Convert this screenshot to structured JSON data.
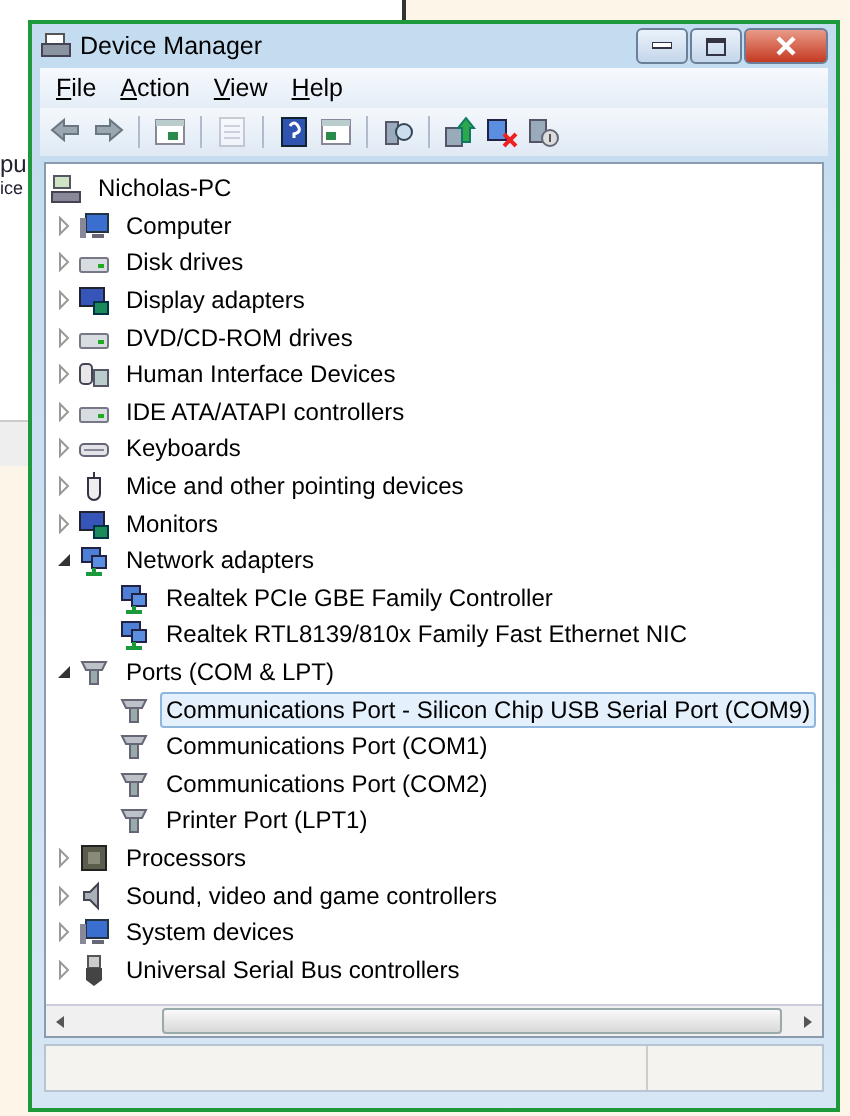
{
  "background_window": {
    "texts": [
      "pu",
      "ice"
    ]
  },
  "window": {
    "title": "Device Manager"
  },
  "menu": [
    "File",
    "Action",
    "View",
    "Help"
  ],
  "toolbar": [
    {
      "kind": "back",
      "disabled": false
    },
    {
      "kind": "forward",
      "disabled": false
    },
    {
      "kind": "tree",
      "disabled": false
    },
    {
      "kind": "properties",
      "disabled": true
    },
    {
      "kind": "help",
      "disabled": false
    },
    {
      "kind": "pane",
      "disabled": false
    },
    {
      "kind": "scan",
      "disabled": false
    },
    {
      "kind": "update",
      "disabled": false
    },
    {
      "kind": "uninstall",
      "disabled": false
    },
    {
      "kind": "disable",
      "disabled": false
    }
  ],
  "tree": {
    "root": {
      "label": "Nicholas-PC",
      "kind": "pc",
      "selected": false,
      "children": [
        {
          "label": "Computer",
          "kind": "computer",
          "expanded": false,
          "selected": false
        },
        {
          "label": "Disk drives",
          "kind": "disk",
          "expanded": false,
          "selected": false
        },
        {
          "label": "Display adapters",
          "kind": "display",
          "expanded": false,
          "selected": false
        },
        {
          "label": "DVD/CD-ROM drives",
          "kind": "disk",
          "expanded": false,
          "selected": false
        },
        {
          "label": "Human Interface Devices",
          "kind": "hid",
          "expanded": false,
          "selected": false
        },
        {
          "label": "IDE ATA/ATAPI controllers",
          "kind": "disk",
          "expanded": false,
          "selected": false
        },
        {
          "label": "Keyboards",
          "kind": "keyboard",
          "expanded": false,
          "selected": false
        },
        {
          "label": "Mice and other pointing devices",
          "kind": "mouse",
          "expanded": false,
          "selected": false
        },
        {
          "label": "Monitors",
          "kind": "display",
          "expanded": false,
          "selected": false
        },
        {
          "label": "Network adapters",
          "kind": "network",
          "expanded": true,
          "selected": false,
          "children": [
            {
              "label": "Realtek PCIe GBE Family Controller",
              "kind": "network",
              "selected": false
            },
            {
              "label": "Realtek RTL8139/810x Family Fast Ethernet NIC",
              "kind": "network",
              "selected": false
            }
          ]
        },
        {
          "label": "Ports (COM & LPT)",
          "kind": "port",
          "expanded": true,
          "selected": false,
          "children": [
            {
              "label": "Communications Port - Silicon Chip USB Serial Port (COM9)",
              "kind": "port",
              "selected": true
            },
            {
              "label": "Communications Port (COM1)",
              "kind": "port",
              "selected": false
            },
            {
              "label": "Communications Port (COM2)",
              "kind": "port",
              "selected": false
            },
            {
              "label": "Printer Port (LPT1)",
              "kind": "port",
              "selected": false
            }
          ]
        },
        {
          "label": "Processors",
          "kind": "chip",
          "expanded": false,
          "selected": false
        },
        {
          "label": "Sound, video and game controllers",
          "kind": "sound",
          "expanded": false,
          "selected": false
        },
        {
          "label": "System devices",
          "kind": "computer",
          "expanded": false,
          "selected": false
        },
        {
          "label": "Universal Serial Bus controllers",
          "kind": "usb",
          "expanded": false,
          "selected": false
        }
      ]
    }
  }
}
